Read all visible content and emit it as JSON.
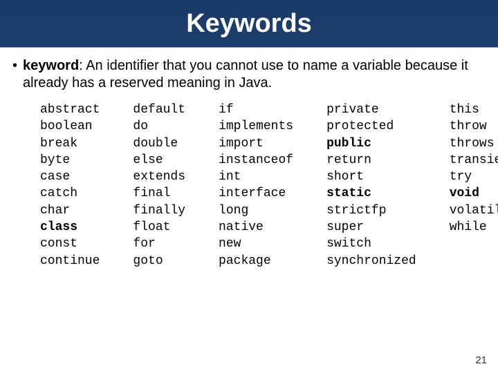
{
  "title": "Keywords",
  "bullet": {
    "term": "keyword",
    "definition": ": An identifier that you cannot use to name a variable because it already has a reserved meaning in Java."
  },
  "columns": [
    [
      {
        "w": "abstract",
        "b": false
      },
      {
        "w": "boolean",
        "b": false
      },
      {
        "w": "break",
        "b": false
      },
      {
        "w": "byte",
        "b": false
      },
      {
        "w": "case",
        "b": false
      },
      {
        "w": "catch",
        "b": false
      },
      {
        "w": "char",
        "b": false
      },
      {
        "w": "class",
        "b": true
      },
      {
        "w": "const",
        "b": false
      },
      {
        "w": "continue",
        "b": false
      }
    ],
    [
      {
        "w": "default",
        "b": false
      },
      {
        "w": "do",
        "b": false
      },
      {
        "w": "double",
        "b": false
      },
      {
        "w": "else",
        "b": false
      },
      {
        "w": "extends",
        "b": false
      },
      {
        "w": "final",
        "b": false
      },
      {
        "w": "finally",
        "b": false
      },
      {
        "w": "float",
        "b": false
      },
      {
        "w": "for",
        "b": false
      },
      {
        "w": "goto",
        "b": false
      }
    ],
    [
      {
        "w": "if",
        "b": false
      },
      {
        "w": "implements",
        "b": false
      },
      {
        "w": "import",
        "b": false
      },
      {
        "w": "instanceof",
        "b": false
      },
      {
        "w": "int",
        "b": false
      },
      {
        "w": "interface",
        "b": false
      },
      {
        "w": "long",
        "b": false
      },
      {
        "w": "native",
        "b": false
      },
      {
        "w": "new",
        "b": false
      },
      {
        "w": "package",
        "b": false
      }
    ],
    [
      {
        "w": "private",
        "b": false
      },
      {
        "w": "protected",
        "b": false
      },
      {
        "w": "public",
        "b": true
      },
      {
        "w": "return",
        "b": false
      },
      {
        "w": "short",
        "b": false
      },
      {
        "w": "static",
        "b": true
      },
      {
        "w": "strictfp",
        "b": false
      },
      {
        "w": "super",
        "b": false
      },
      {
        "w": "switch",
        "b": false
      },
      {
        "w": "synchronized",
        "b": false
      }
    ],
    [
      {
        "w": "this",
        "b": false
      },
      {
        "w": "throw",
        "b": false
      },
      {
        "w": "throws",
        "b": false
      },
      {
        "w": "transient",
        "b": false
      },
      {
        "w": "try",
        "b": false
      },
      {
        "w": "void",
        "b": true
      },
      {
        "w": "volatile",
        "b": false
      },
      {
        "w": "while",
        "b": false
      }
    ]
  ],
  "page_number": "21"
}
